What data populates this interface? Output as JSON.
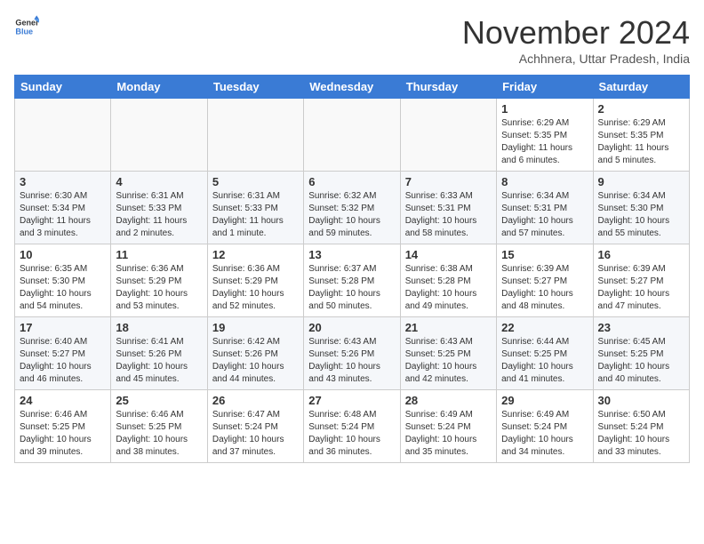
{
  "header": {
    "logo_line1": "General",
    "logo_line2": "Blue",
    "month": "November 2024",
    "location": "Achhnera, Uttar Pradesh, India"
  },
  "weekdays": [
    "Sunday",
    "Monday",
    "Tuesday",
    "Wednesday",
    "Thursday",
    "Friday",
    "Saturday"
  ],
  "weeks": [
    [
      {
        "day": "",
        "info": ""
      },
      {
        "day": "",
        "info": ""
      },
      {
        "day": "",
        "info": ""
      },
      {
        "day": "",
        "info": ""
      },
      {
        "day": "",
        "info": ""
      },
      {
        "day": "1",
        "info": "Sunrise: 6:29 AM\nSunset: 5:35 PM\nDaylight: 11 hours and 6 minutes."
      },
      {
        "day": "2",
        "info": "Sunrise: 6:29 AM\nSunset: 5:35 PM\nDaylight: 11 hours and 5 minutes."
      }
    ],
    [
      {
        "day": "3",
        "info": "Sunrise: 6:30 AM\nSunset: 5:34 PM\nDaylight: 11 hours and 3 minutes."
      },
      {
        "day": "4",
        "info": "Sunrise: 6:31 AM\nSunset: 5:33 PM\nDaylight: 11 hours and 2 minutes."
      },
      {
        "day": "5",
        "info": "Sunrise: 6:31 AM\nSunset: 5:33 PM\nDaylight: 11 hours and 1 minute."
      },
      {
        "day": "6",
        "info": "Sunrise: 6:32 AM\nSunset: 5:32 PM\nDaylight: 10 hours and 59 minutes."
      },
      {
        "day": "7",
        "info": "Sunrise: 6:33 AM\nSunset: 5:31 PM\nDaylight: 10 hours and 58 minutes."
      },
      {
        "day": "8",
        "info": "Sunrise: 6:34 AM\nSunset: 5:31 PM\nDaylight: 10 hours and 57 minutes."
      },
      {
        "day": "9",
        "info": "Sunrise: 6:34 AM\nSunset: 5:30 PM\nDaylight: 10 hours and 55 minutes."
      }
    ],
    [
      {
        "day": "10",
        "info": "Sunrise: 6:35 AM\nSunset: 5:30 PM\nDaylight: 10 hours and 54 minutes."
      },
      {
        "day": "11",
        "info": "Sunrise: 6:36 AM\nSunset: 5:29 PM\nDaylight: 10 hours and 53 minutes."
      },
      {
        "day": "12",
        "info": "Sunrise: 6:36 AM\nSunset: 5:29 PM\nDaylight: 10 hours and 52 minutes."
      },
      {
        "day": "13",
        "info": "Sunrise: 6:37 AM\nSunset: 5:28 PM\nDaylight: 10 hours and 50 minutes."
      },
      {
        "day": "14",
        "info": "Sunrise: 6:38 AM\nSunset: 5:28 PM\nDaylight: 10 hours and 49 minutes."
      },
      {
        "day": "15",
        "info": "Sunrise: 6:39 AM\nSunset: 5:27 PM\nDaylight: 10 hours and 48 minutes."
      },
      {
        "day": "16",
        "info": "Sunrise: 6:39 AM\nSunset: 5:27 PM\nDaylight: 10 hours and 47 minutes."
      }
    ],
    [
      {
        "day": "17",
        "info": "Sunrise: 6:40 AM\nSunset: 5:27 PM\nDaylight: 10 hours and 46 minutes."
      },
      {
        "day": "18",
        "info": "Sunrise: 6:41 AM\nSunset: 5:26 PM\nDaylight: 10 hours and 45 minutes."
      },
      {
        "day": "19",
        "info": "Sunrise: 6:42 AM\nSunset: 5:26 PM\nDaylight: 10 hours and 44 minutes."
      },
      {
        "day": "20",
        "info": "Sunrise: 6:43 AM\nSunset: 5:26 PM\nDaylight: 10 hours and 43 minutes."
      },
      {
        "day": "21",
        "info": "Sunrise: 6:43 AM\nSunset: 5:25 PM\nDaylight: 10 hours and 42 minutes."
      },
      {
        "day": "22",
        "info": "Sunrise: 6:44 AM\nSunset: 5:25 PM\nDaylight: 10 hours and 41 minutes."
      },
      {
        "day": "23",
        "info": "Sunrise: 6:45 AM\nSunset: 5:25 PM\nDaylight: 10 hours and 40 minutes."
      }
    ],
    [
      {
        "day": "24",
        "info": "Sunrise: 6:46 AM\nSunset: 5:25 PM\nDaylight: 10 hours and 39 minutes."
      },
      {
        "day": "25",
        "info": "Sunrise: 6:46 AM\nSunset: 5:25 PM\nDaylight: 10 hours and 38 minutes."
      },
      {
        "day": "26",
        "info": "Sunrise: 6:47 AM\nSunset: 5:24 PM\nDaylight: 10 hours and 37 minutes."
      },
      {
        "day": "27",
        "info": "Sunrise: 6:48 AM\nSunset: 5:24 PM\nDaylight: 10 hours and 36 minutes."
      },
      {
        "day": "28",
        "info": "Sunrise: 6:49 AM\nSunset: 5:24 PM\nDaylight: 10 hours and 35 minutes."
      },
      {
        "day": "29",
        "info": "Sunrise: 6:49 AM\nSunset: 5:24 PM\nDaylight: 10 hours and 34 minutes."
      },
      {
        "day": "30",
        "info": "Sunrise: 6:50 AM\nSunset: 5:24 PM\nDaylight: 10 hours and 33 minutes."
      }
    ]
  ]
}
